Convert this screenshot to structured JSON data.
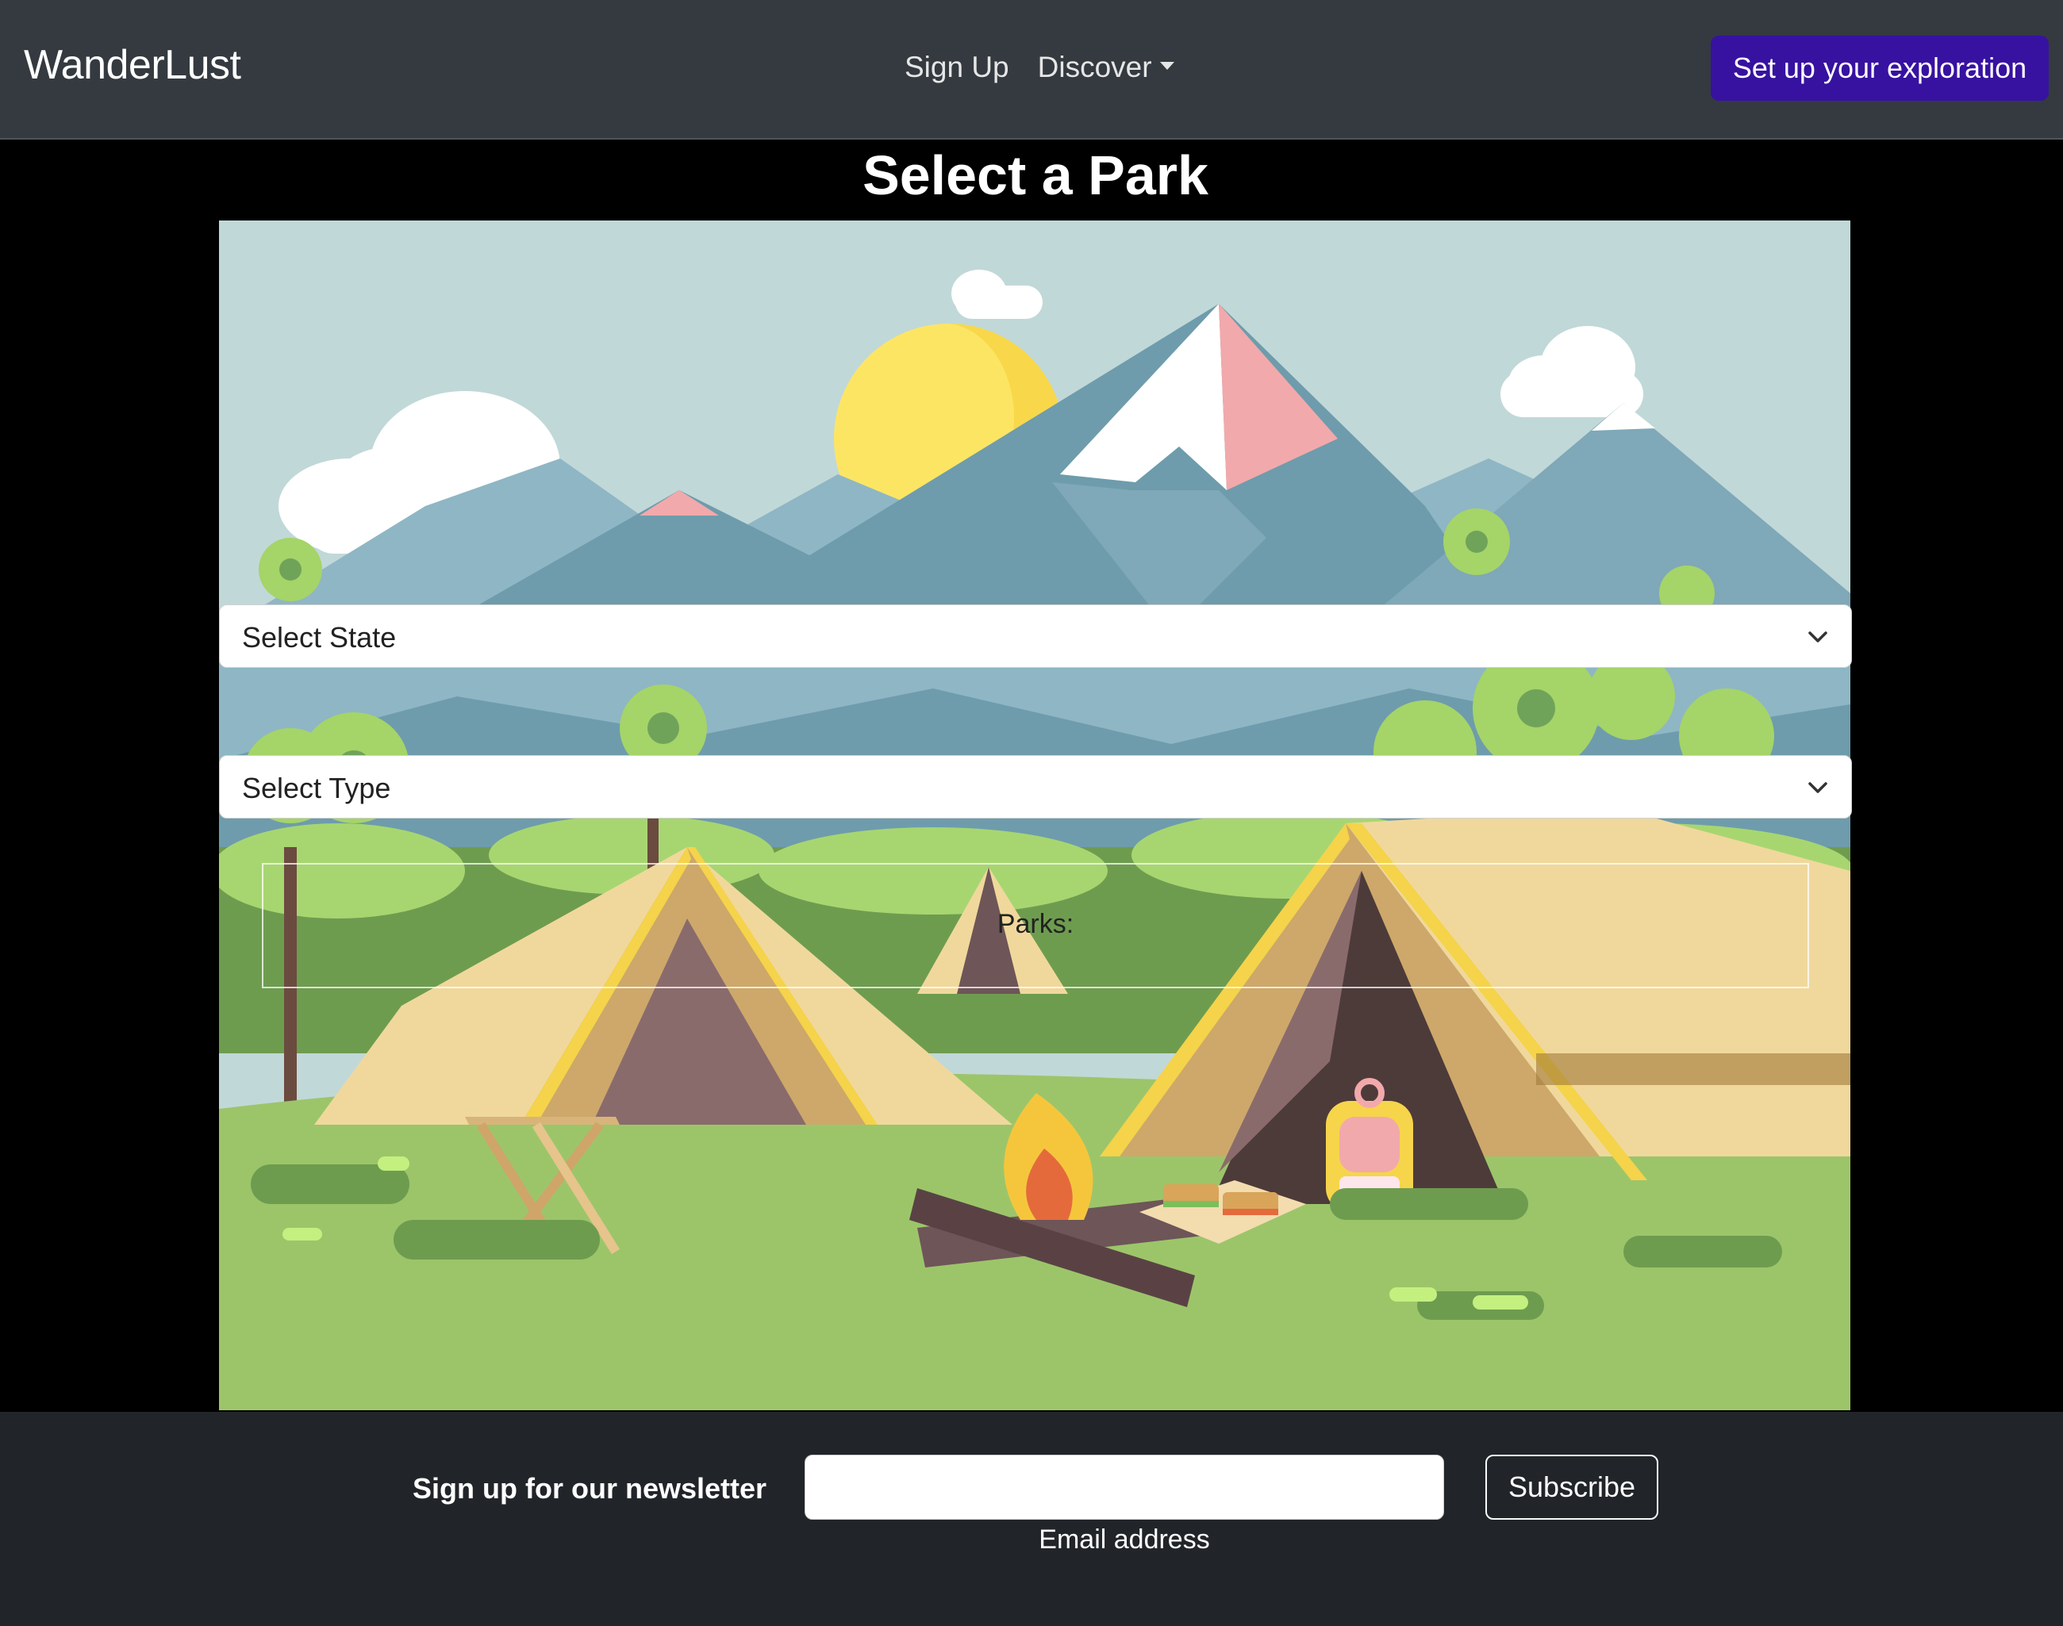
{
  "navbar": {
    "brand": "WanderLust",
    "links": [
      {
        "label": "Sign Up"
      },
      {
        "label": "Discover"
      }
    ],
    "cta_label": "Set up your exploration"
  },
  "main": {
    "title": "Select a Park",
    "state_select": {
      "selected": "Select State"
    },
    "type_select": {
      "selected": "Select Type"
    },
    "parks_label": "Parks:"
  },
  "footer": {
    "newsletter_label": "Sign up for our newsletter",
    "email_value": "",
    "email_help": "Email address",
    "subscribe_label": "Subscribe"
  },
  "colors": {
    "navbar_bg": "#343a40",
    "cta_bg": "#3712a0",
    "footer_bg": "#212529",
    "sky": "#c1d8d8"
  }
}
